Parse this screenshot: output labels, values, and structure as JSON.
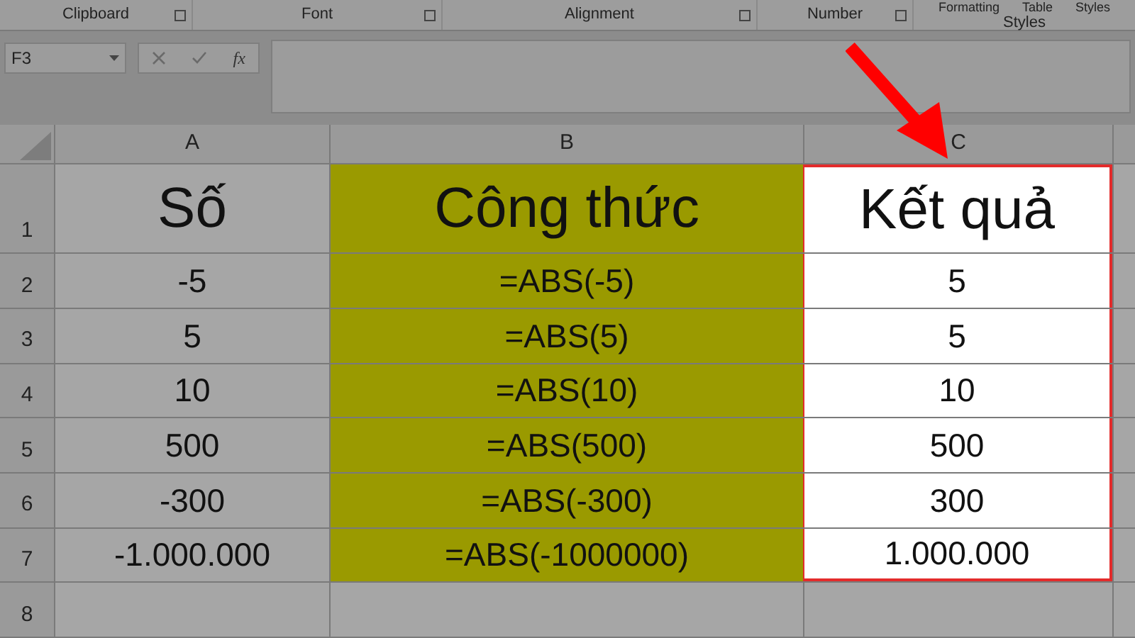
{
  "ribbon": {
    "groups": [
      {
        "label": "Clipboard"
      },
      {
        "label": "Font"
      },
      {
        "label": "Alignment"
      },
      {
        "label": "Number"
      }
    ],
    "styles_group": {
      "items": [
        "Formatting",
        "Table",
        "Styles"
      ],
      "label": "Styles"
    }
  },
  "formula_bar": {
    "name_box": "F3",
    "fx": "fx"
  },
  "columns": [
    {
      "label": "A",
      "shaded": false,
      "highlighted": false
    },
    {
      "label": "B",
      "shaded": true,
      "highlighted": false
    },
    {
      "label": "C",
      "shaded": false,
      "highlighted": true
    }
  ],
  "rows": [
    {
      "number": "1",
      "cells": [
        "Số",
        "Công thức",
        "Kết quả"
      ]
    },
    {
      "number": "2",
      "cells": [
        "-5",
        "=ABS(-5)",
        "5"
      ]
    },
    {
      "number": "3",
      "cells": [
        "5",
        "=ABS(5)",
        "5"
      ]
    },
    {
      "number": "4",
      "cells": [
        "10",
        "=ABS(10)",
        "10"
      ]
    },
    {
      "number": "5",
      "cells": [
        "500",
        "=ABS(500)",
        "500"
      ]
    },
    {
      "number": "6",
      "cells": [
        "-300",
        "=ABS(-300)",
        "300"
      ]
    },
    {
      "number": "7",
      "cells": [
        "-1.000.000",
        "=ABS(-1000000)",
        "1.000.000"
      ]
    },
    {
      "number": "8",
      "cells": []
    }
  ]
}
